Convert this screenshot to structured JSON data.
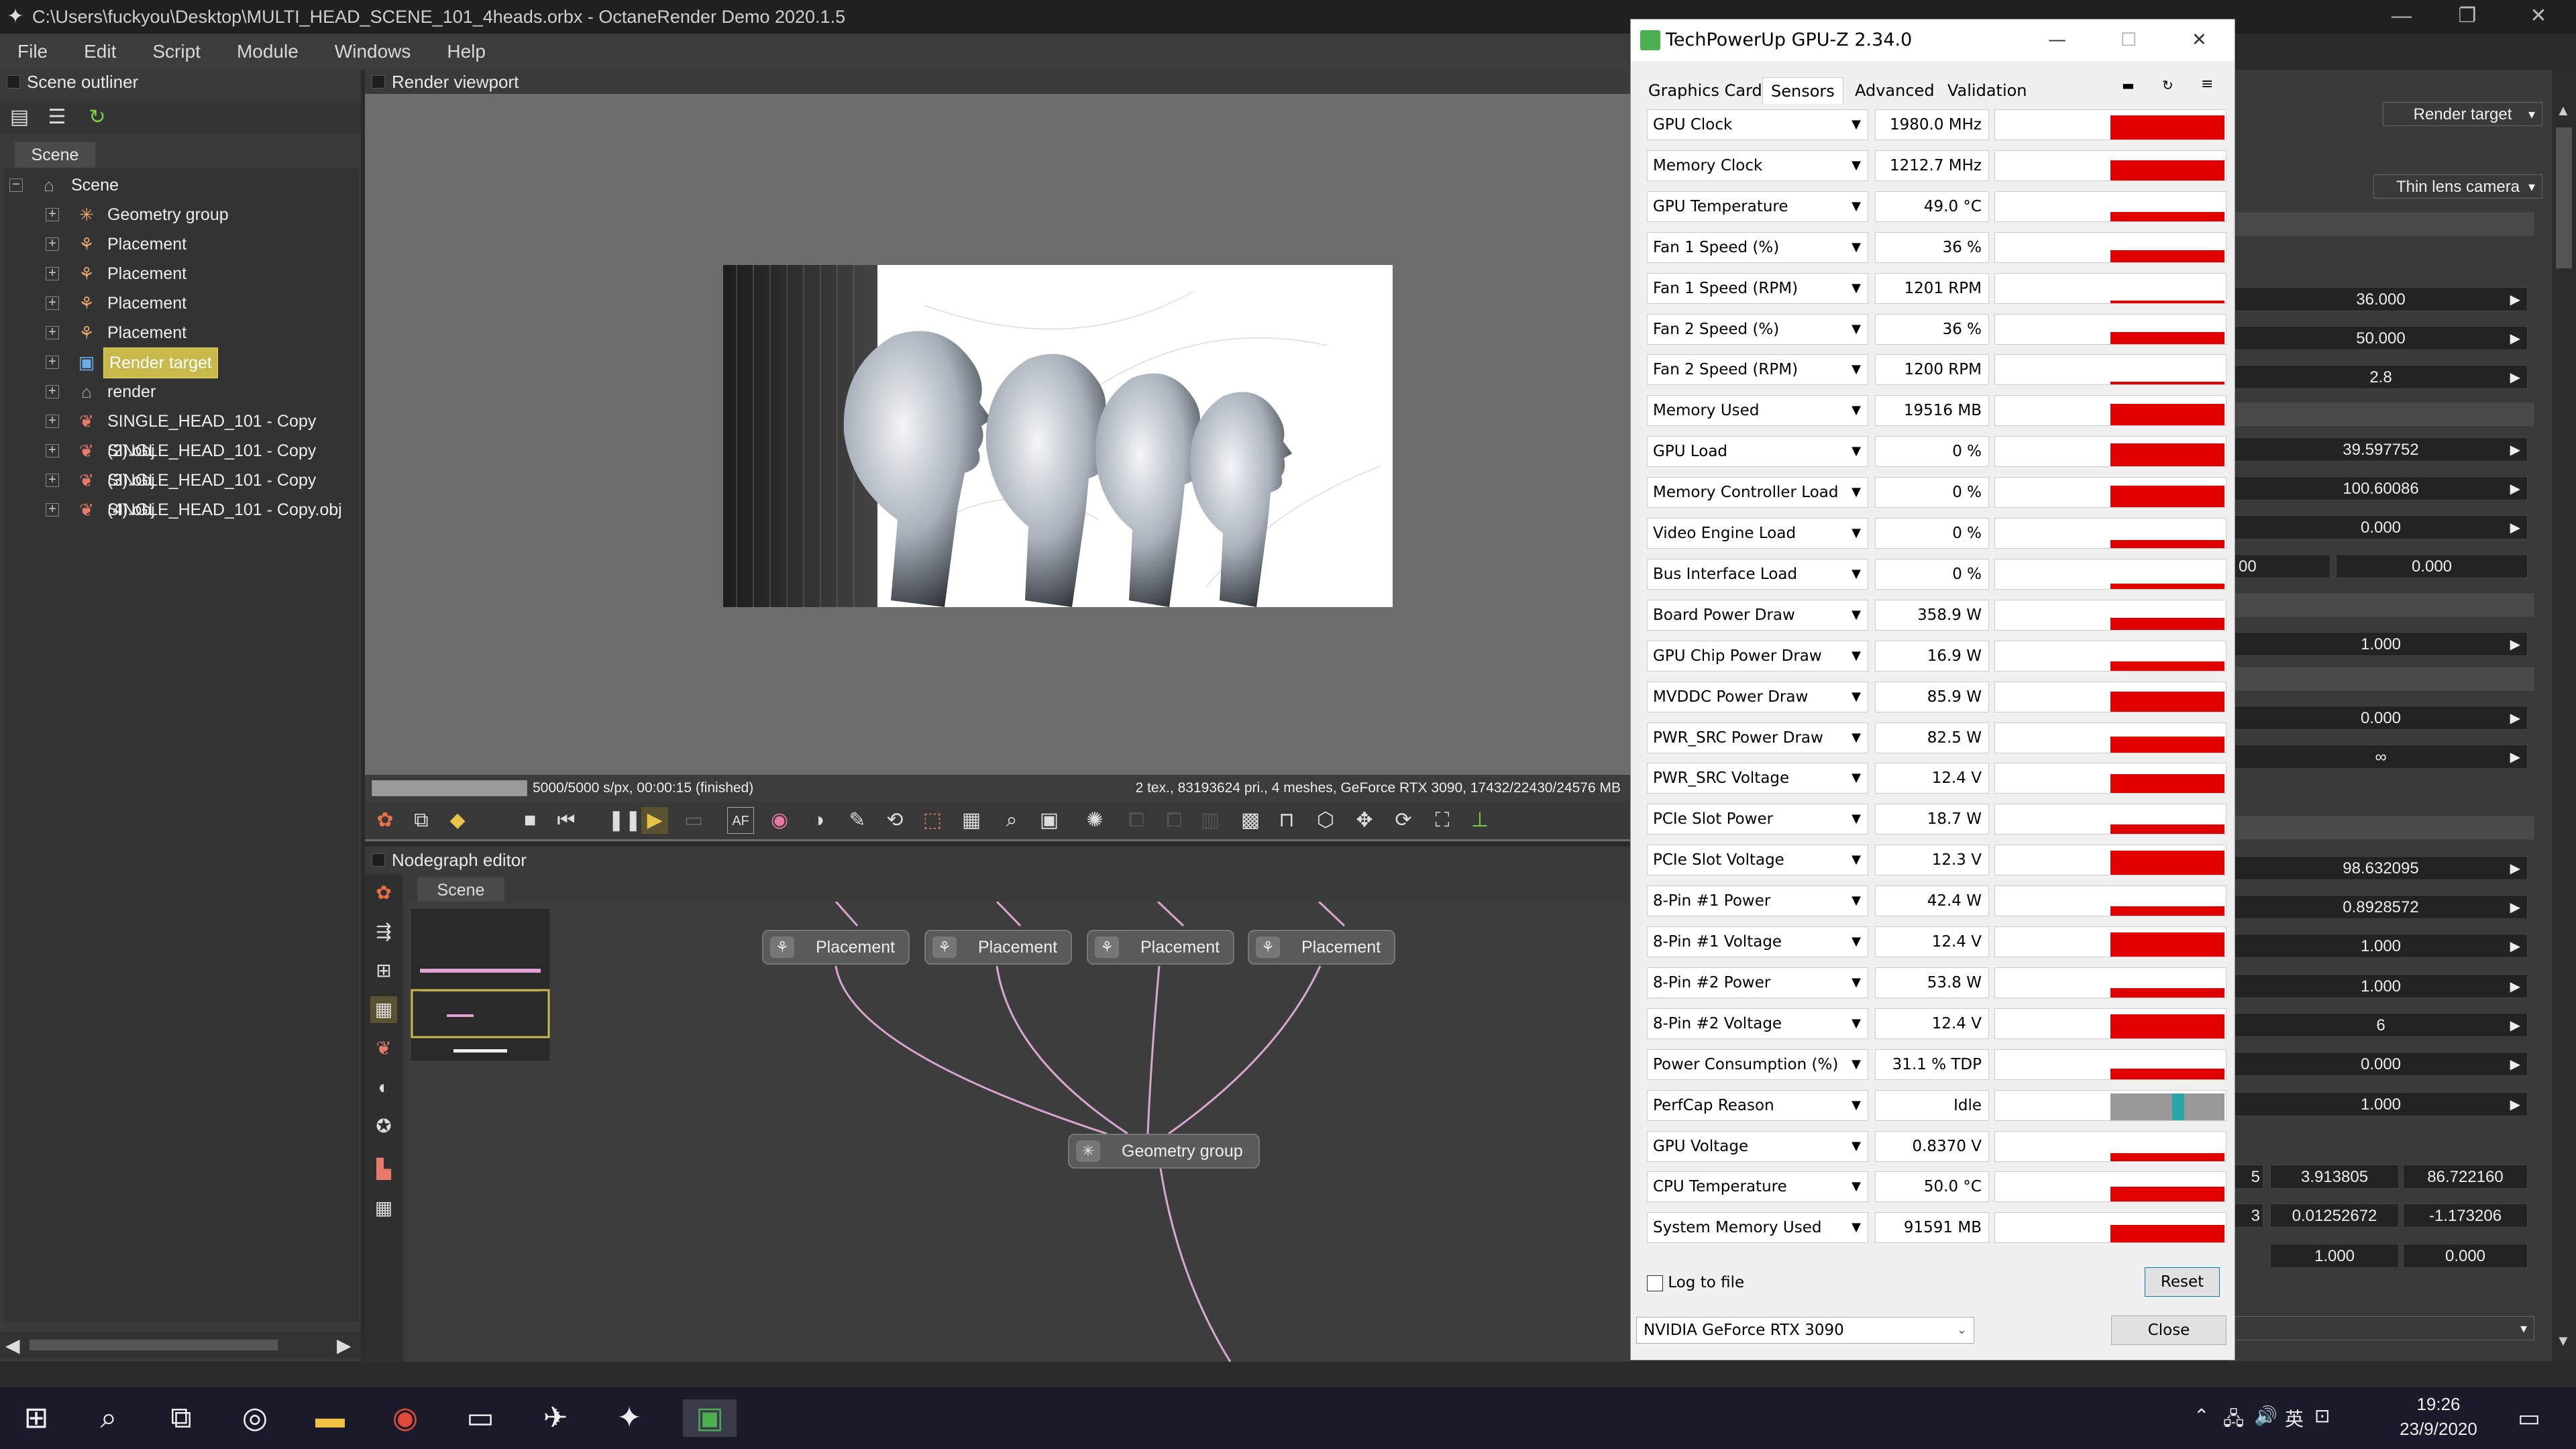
{
  "window": {
    "title": "C:\\Users\\fuckyou\\Desktop\\MULTI_HEAD_SCENE_101_4heads.orbx - OctaneRender Demo 2020.1.5"
  },
  "menu": [
    "File",
    "Edit",
    "Script",
    "Module",
    "Windows",
    "Help"
  ],
  "outliner": {
    "title": "Scene outliner",
    "tab": "Scene",
    "items": [
      {
        "label": "Scene",
        "icon": "scene-icon"
      },
      {
        "label": "Geometry group",
        "icon": "geometry-group-icon"
      },
      {
        "label": "Placement",
        "icon": "placement-icon"
      },
      {
        "label": "Placement",
        "icon": "placement-icon"
      },
      {
        "label": "Placement",
        "icon": "placement-icon"
      },
      {
        "label": "Placement",
        "icon": "placement-icon"
      },
      {
        "label": "Render target",
        "icon": "render-target-icon",
        "selected": true
      },
      {
        "label": "render",
        "icon": "render-icon"
      },
      {
        "label": "SINGLE_HEAD_101 - Copy (2).obj",
        "icon": "mesh-icon"
      },
      {
        "label": "SINGLE_HEAD_101 - Copy (3).obj",
        "icon": "mesh-icon"
      },
      {
        "label": "SINGLE_HEAD_101 - Copy (4).obj",
        "icon": "mesh-icon"
      },
      {
        "label": "SINGLE_HEAD_101 - Copy.obj",
        "icon": "mesh-icon"
      }
    ]
  },
  "viewport": {
    "title": "Render viewport",
    "progress_text": "5000/5000 s/px, 00:00:15 (finished)",
    "progress": 1.0,
    "stats": "2 tex., 83193624 pri., 4 meshes, GeForce RTX 3090, 17432/22430/24576 MB"
  },
  "nodegraph": {
    "title": "Nodegraph editor",
    "tab": "Scene",
    "nodes": [
      {
        "label": "Placement"
      },
      {
        "label": "Placement"
      },
      {
        "label": "Placement"
      },
      {
        "label": "Placement"
      },
      {
        "label": "Geometry group"
      }
    ]
  },
  "right_panel": {
    "render_target": "Render target",
    "camera": "Thin lens camera",
    "values": [
      "36.000",
      "50.000",
      "2.8",
      "39.597752",
      "100.60086",
      "0.000",
      "00",
      "0.000",
      "1.000",
      "0.000",
      "∞",
      "98.632095",
      "0.8928572",
      "1.000",
      "1.000",
      "6",
      "0.000",
      "1.000",
      "5",
      "3.913805",
      "86.722160",
      "3",
      "0.01252672",
      "-1.173206",
      "1.000",
      "0.000"
    ]
  },
  "gpuz": {
    "title": "TechPowerUp GPU-Z 2.34.0",
    "tabs": [
      "Graphics Card",
      "Sensors",
      "Advanced",
      "Validation"
    ],
    "active_tab": "Sensors",
    "sensors": [
      {
        "name": "GPU Clock",
        "value": "1980.0 MHz"
      },
      {
        "name": "Memory Clock",
        "value": "1212.7 MHz"
      },
      {
        "name": "GPU Temperature",
        "value": "49.0 °C"
      },
      {
        "name": "Fan 1 Speed (%)",
        "value": "36 %"
      },
      {
        "name": "Fan 1 Speed (RPM)",
        "value": "1201 RPM"
      },
      {
        "name": "Fan 2 Speed (%)",
        "value": "36 %"
      },
      {
        "name": "Fan 2 Speed (RPM)",
        "value": "1200 RPM"
      },
      {
        "name": "Memory Used",
        "value": "19516 MB"
      },
      {
        "name": "GPU Load",
        "value": "0 %"
      },
      {
        "name": "Memory Controller Load",
        "value": "0 %"
      },
      {
        "name": "Video Engine Load",
        "value": "0 %"
      },
      {
        "name": "Bus Interface Load",
        "value": "0 %"
      },
      {
        "name": "Board Power Draw",
        "value": "358.9 W"
      },
      {
        "name": "GPU Chip Power Draw",
        "value": "16.9 W"
      },
      {
        "name": "MVDDC Power Draw",
        "value": "85.9 W"
      },
      {
        "name": "PWR_SRC Power Draw",
        "value": "82.5 W"
      },
      {
        "name": "PWR_SRC Voltage",
        "value": "12.4 V"
      },
      {
        "name": "PCIe Slot Power",
        "value": "18.7 W"
      },
      {
        "name": "PCIe Slot Voltage",
        "value": "12.3 V"
      },
      {
        "name": "8-Pin #1 Power",
        "value": "42.4 W"
      },
      {
        "name": "8-Pin #1 Voltage",
        "value": "12.4 V"
      },
      {
        "name": "8-Pin #2 Power",
        "value": "53.8 W"
      },
      {
        "name": "8-Pin #2 Voltage",
        "value": "12.4 V"
      },
      {
        "name": "Power Consumption (%)",
        "value": "31.1 % TDP"
      },
      {
        "name": "PerfCap Reason",
        "value": "Idle"
      },
      {
        "name": "GPU Voltage",
        "value": "0.8370 V"
      },
      {
        "name": "CPU Temperature",
        "value": "50.0 °C"
      },
      {
        "name": "System Memory Used",
        "value": "91591 MB"
      }
    ],
    "log_label": "Log to file",
    "reset": "Reset",
    "gpu_select": "NVIDIA GeForce RTX 3090",
    "close": "Close"
  },
  "taskbar": {
    "time": "19:26",
    "date": "23/9/2020",
    "lang": "英"
  }
}
